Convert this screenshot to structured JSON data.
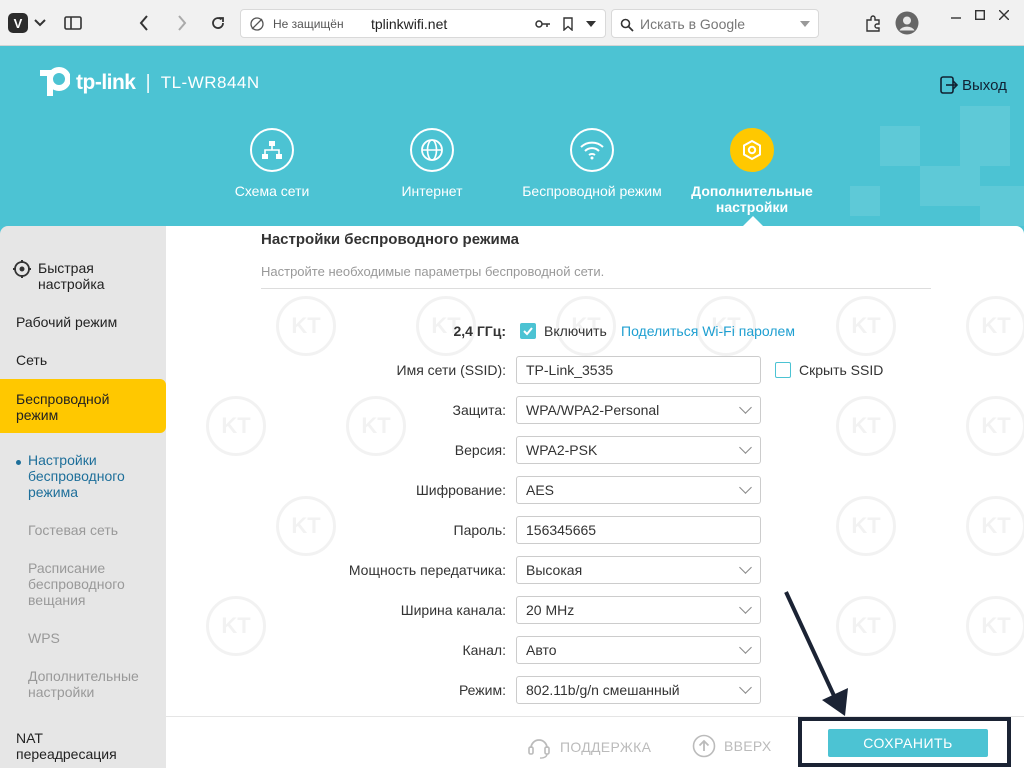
{
  "browser": {
    "security_label": "Не защищён",
    "url": "tplinkwifi.net",
    "search_placeholder": "Искать в Google"
  },
  "header": {
    "brand": "tp-link",
    "model": "TL-WR844N",
    "logout_label": "Выход",
    "nav": [
      {
        "label": "Схема сети",
        "icon": "network-map-icon"
      },
      {
        "label": "Интернет",
        "icon": "globe-icon"
      },
      {
        "label": "Беспроводной режим",
        "icon": "wifi-icon"
      },
      {
        "label": "Дополнительные настройки",
        "icon": "gear-icon",
        "active": true
      }
    ]
  },
  "sidebar": {
    "quick_setup": "Быстрая настройка",
    "items": [
      {
        "label": "Рабочий режим"
      },
      {
        "label": "Сеть"
      },
      {
        "label": "Беспроводной режим",
        "active": true
      },
      {
        "label": "NAT переадресация"
      }
    ],
    "subitems": [
      {
        "label": "Настройки беспроводного режима",
        "current": true
      },
      {
        "label": "Гостевая сеть"
      },
      {
        "label": "Расписание беспроводного вещания"
      },
      {
        "label": "WPS"
      },
      {
        "label": "Дополнительные настройки"
      }
    ]
  },
  "main": {
    "title": "Настройки беспроводного режима",
    "subtitle": "Настройте необходимые параметры беспроводной сети.",
    "band_label": "2,4 ГГц:",
    "enable_label": "Включить",
    "enable_checked": true,
    "share_link": "Поделиться Wi-Fi паролем",
    "hide_ssid_label": "Скрыть SSID",
    "hide_ssid_checked": false,
    "fields": [
      {
        "label": "Имя сети (SSID):",
        "value": "TP-Link_3535",
        "type": "text"
      },
      {
        "label": "Защита:",
        "value": "WPA/WPA2-Personal",
        "type": "select"
      },
      {
        "label": "Версия:",
        "value": "WPA2-PSK",
        "type": "select"
      },
      {
        "label": "Шифрование:",
        "value": "AES",
        "type": "select"
      },
      {
        "label": "Пароль:",
        "value": "156345665",
        "type": "text"
      },
      {
        "label": "Мощность передатчика:",
        "value": "Высокая",
        "type": "select"
      },
      {
        "label": "Ширина канала:",
        "value": "20 MHz",
        "type": "select"
      },
      {
        "label": "Канал:",
        "value": "Авто",
        "type": "select"
      },
      {
        "label": "Режим:",
        "value": "802.11b/g/n смешанный",
        "type": "select"
      }
    ]
  },
  "footer": {
    "support_label": "ПОДДЕРЖКА",
    "top_label": "ВВЕРХ",
    "save_label": "СОХРАНИТЬ"
  },
  "colors": {
    "accent": "#4cc3d3",
    "active": "#ffc800",
    "link": "#1e9fd1"
  }
}
